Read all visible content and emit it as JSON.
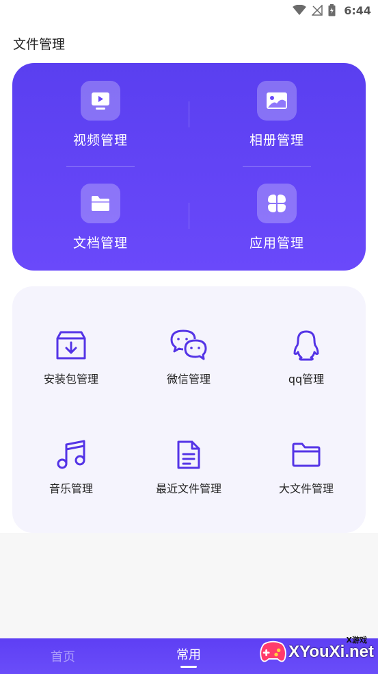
{
  "status_bar": {
    "time": "6:44"
  },
  "section_title": "文件管理",
  "primary": {
    "items": [
      {
        "label": "视频管理",
        "icon": "video-icon"
      },
      {
        "label": "相册管理",
        "icon": "album-icon"
      },
      {
        "label": "文档管理",
        "icon": "folder-icon"
      },
      {
        "label": "应用管理",
        "icon": "apps-icon"
      }
    ]
  },
  "secondary": {
    "items": [
      {
        "label": "安装包管理",
        "icon": "package-icon"
      },
      {
        "label": "微信管理",
        "icon": "wechat-icon"
      },
      {
        "label": "qq管理",
        "icon": "qq-icon"
      },
      {
        "label": "音乐管理",
        "icon": "music-icon"
      },
      {
        "label": "最近文件管理",
        "icon": "document-icon"
      },
      {
        "label": "大文件管理",
        "icon": "folder-outline-icon"
      }
    ]
  },
  "bottom_nav": {
    "tabs": [
      {
        "label": "首页",
        "active": false
      },
      {
        "label": "常用",
        "active": true
      }
    ]
  },
  "watermark": {
    "text": "XYouXi.net",
    "small": "X游戏"
  },
  "colors": {
    "accent": "#5b3ff2",
    "icon_stroke": "#5434e6",
    "card_bg": "#f5f4fd"
  }
}
